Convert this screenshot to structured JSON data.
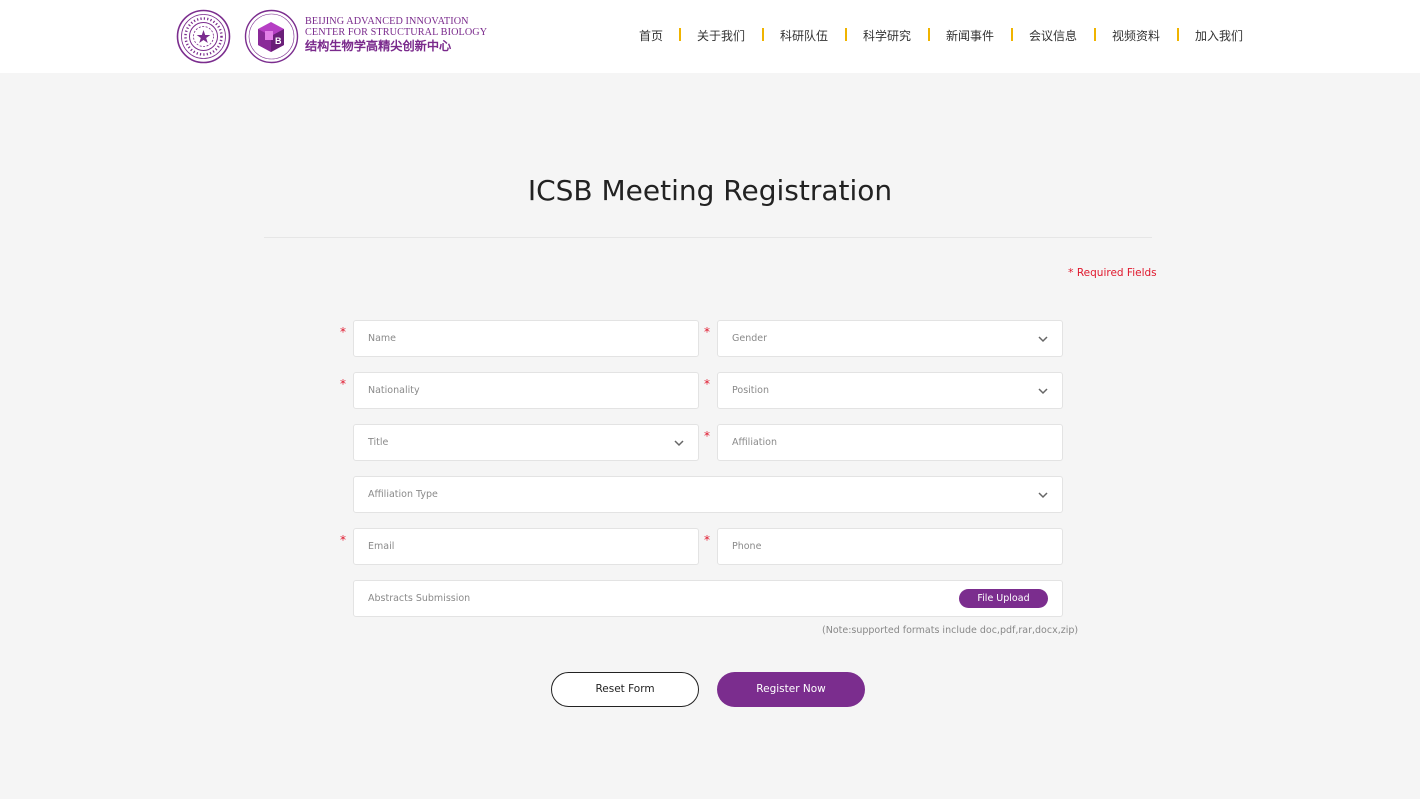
{
  "header": {
    "logo_en_line1": "BEIJING ADVANCED INNOVATION",
    "logo_en_line2": "CENTER FOR STRUCTURAL BIOLOGY",
    "logo_cn": "结构生物学高精尖创新中心",
    "nav": [
      "首页",
      "关于我们",
      "科研队伍",
      "科学研究",
      "新闻事件",
      "会议信息",
      "视频资料",
      "加入我们"
    ]
  },
  "page": {
    "title": "ICSB Meeting Registration",
    "required_star": "*",
    "required_text": "Required Fields"
  },
  "form": {
    "required_marker": "*",
    "name_placeholder": "Name",
    "gender_label": "Gender",
    "nationality_placeholder": "Nationality",
    "position_label": "Position",
    "title_label": "Title",
    "affiliation_placeholder": "Affiliation",
    "affiliation_type_label": "Affiliation Type",
    "email_placeholder": "Email",
    "phone_placeholder": "Phone",
    "abstracts_placeholder": "Abstracts Submission",
    "file_upload_label": "File Upload",
    "format_note": "(Note:supported formats include doc,pdf,rar,docx,zip)",
    "reset_label": "Reset Form",
    "register_label": "Register Now"
  },
  "colors": {
    "brand_purple": "#7b2d8e",
    "required_red": "#e0182d",
    "nav_separator": "#f0b400"
  },
  "icons": [
    "university-seal-icon",
    "bicsb-logo-icon",
    "chevron-down-icon"
  ]
}
